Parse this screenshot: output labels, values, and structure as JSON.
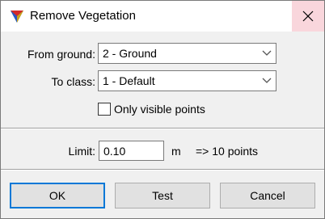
{
  "window": {
    "title": "Remove Vegetation",
    "app_icon": "colorful-triangle-icon",
    "close_icon": "close-icon"
  },
  "form": {
    "from_ground_label": "From ground:",
    "from_ground_value": "2 - Ground",
    "to_class_label": "To class:",
    "to_class_value": "1 - Default",
    "only_visible_label": "Only visible points",
    "only_visible_checked": false,
    "limit_label": "Limit:",
    "limit_value": "0.10",
    "limit_unit": "m",
    "limit_result": "=> 10 points"
  },
  "buttons": {
    "ok": "OK",
    "test": "Test",
    "cancel": "Cancel"
  },
  "colors": {
    "close_hover_bg": "#f9d6dc",
    "default_button_border": "#0078d7",
    "dialog_bg": "#f0f0f0"
  }
}
